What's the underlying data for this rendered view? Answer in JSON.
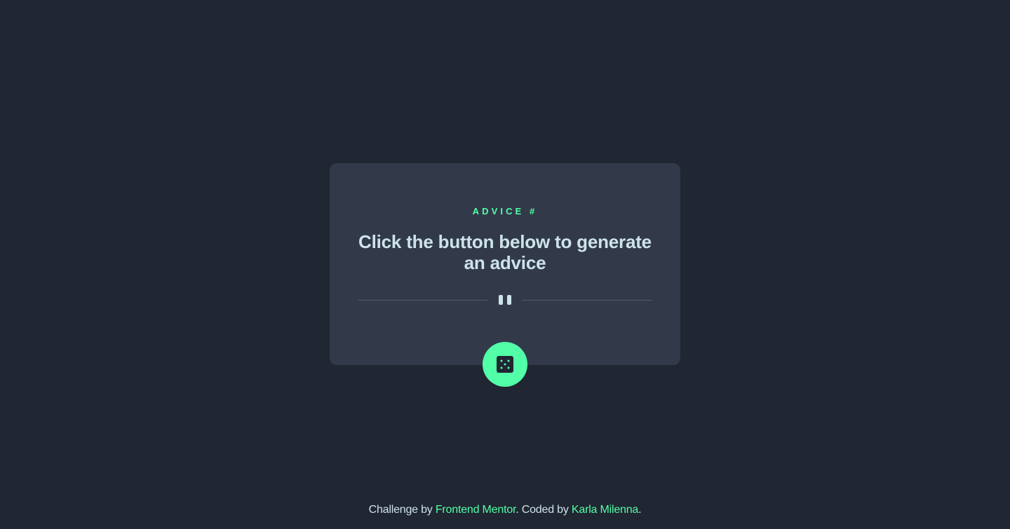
{
  "card": {
    "advice_label": "ADVICE #",
    "advice_text": "Click the button below to generate an advice"
  },
  "divider": {
    "icon": "pause-icon"
  },
  "dice_button": {
    "icon": "dice-icon"
  },
  "footer": {
    "prefix": "Challenge by ",
    "link1": "Frontend Mentor",
    "middle": ". Coded by ",
    "link2": "Karla Milenna",
    "suffix": "."
  },
  "colors": {
    "background": "#202632",
    "card": "#323a4a",
    "accent": "#52ffa8",
    "text": "#cee3e9",
    "divider": "#4f5b6c"
  }
}
